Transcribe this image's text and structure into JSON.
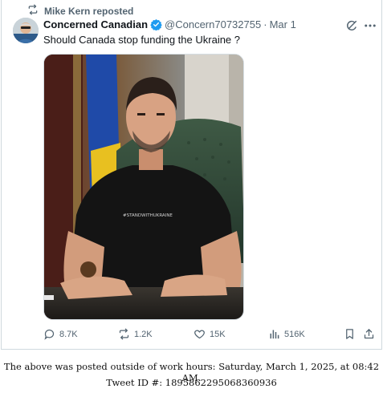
{
  "repost": {
    "text": "Mike Kern reposted",
    "icon": "repost-icon"
  },
  "author": {
    "display_name": "Concerned Canadian",
    "verified": true,
    "verified_color": "#1d9bf0",
    "handle": "@Concern70732755",
    "separator": "·",
    "date": "Mar 1"
  },
  "tweet": {
    "text": "Should Canada stop funding the Ukraine ?",
    "image_shirt_text": "#STANDWITHUKRAINE"
  },
  "actions": {
    "replies": "8.7K",
    "reposts": "1.2K",
    "likes": "15K",
    "views": "516K"
  },
  "footer": {
    "line1": "The above was posted outside of work hours: Saturday, March 1, 2025, at 08:42 AM.",
    "line2": "Tweet ID #: 1895862295068360936"
  },
  "colors": {
    "secondary_text": "#536471",
    "primary_text": "#0f1419",
    "border": "#cfd9de"
  }
}
